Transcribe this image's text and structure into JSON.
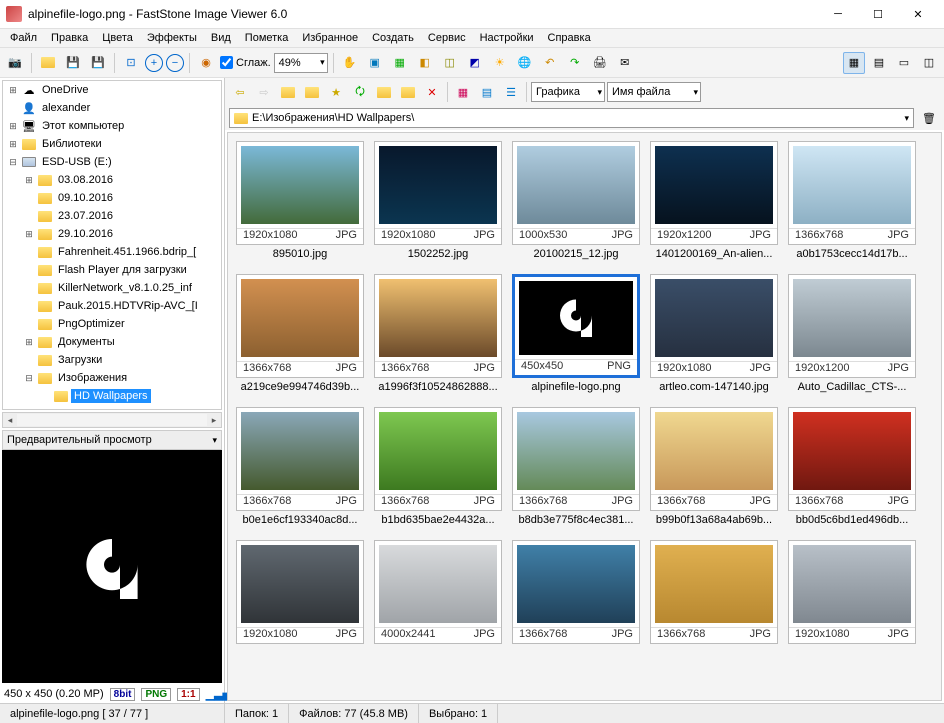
{
  "window": {
    "title": "alpinefile-logo.png  -  FastStone Image Viewer 6.0"
  },
  "menu": [
    "Файл",
    "Правка",
    "Цвета",
    "Эффекты",
    "Вид",
    "Пометка",
    "Избранное",
    "Создать",
    "Сервис",
    "Настройки",
    "Справка"
  ],
  "toolbar": {
    "smooth_label": "Сглаж.",
    "zoom_value": "49%",
    "view_combo": "Графика",
    "sort_combo": "Имя файла"
  },
  "path": "E:\\Изображения\\HD Wallpapers\\",
  "tree": [
    {
      "ind": 0,
      "exp": "+",
      "ico": "cloud",
      "label": "OneDrive"
    },
    {
      "ind": 0,
      "exp": "",
      "ico": "user",
      "label": "alexander"
    },
    {
      "ind": 0,
      "exp": "+",
      "ico": "pc",
      "label": "Этот компьютер"
    },
    {
      "ind": 0,
      "exp": "+",
      "ico": "lib",
      "label": "Библиотеки"
    },
    {
      "ind": 0,
      "exp": "-",
      "ico": "drv",
      "label": "ESD-USB (E:)"
    },
    {
      "ind": 1,
      "exp": "+",
      "ico": "fld",
      "label": "03.08.2016"
    },
    {
      "ind": 1,
      "exp": "",
      "ico": "fld",
      "label": "09.10.2016"
    },
    {
      "ind": 1,
      "exp": "",
      "ico": "fld",
      "label": "23.07.2016"
    },
    {
      "ind": 1,
      "exp": "+",
      "ico": "fld",
      "label": "29.10.2016"
    },
    {
      "ind": 1,
      "exp": "",
      "ico": "fld",
      "label": "Fahrenheit.451.1966.bdrip_["
    },
    {
      "ind": 1,
      "exp": "",
      "ico": "fld",
      "label": "Flash Player для загрузки"
    },
    {
      "ind": 1,
      "exp": "",
      "ico": "fld",
      "label": "KillerNetwork_v8.1.0.25_inf"
    },
    {
      "ind": 1,
      "exp": "",
      "ico": "fld",
      "label": "Pauk.2015.HDTVRip-AVC_[I"
    },
    {
      "ind": 1,
      "exp": "",
      "ico": "fld",
      "label": "PngOptimizer"
    },
    {
      "ind": 1,
      "exp": "+",
      "ico": "fld",
      "label": "Документы"
    },
    {
      "ind": 1,
      "exp": "",
      "ico": "fld",
      "label": "Загрузки"
    },
    {
      "ind": 1,
      "exp": "-",
      "ico": "fld",
      "label": "Изображения"
    },
    {
      "ind": 2,
      "exp": "",
      "ico": "fld",
      "label": "HD Wallpapers",
      "sel": true
    }
  ],
  "preview": {
    "header": "Предварительный просмотр",
    "info": "450 x 450 (0.20 MP)",
    "bit": "8bit",
    "fmt": "PNG",
    "ratio": "1:1"
  },
  "thumbs": [
    {
      "dim": "1920x1080",
      "fmt": "JPG",
      "name": "895010.jpg",
      "c": "linear-gradient(#7bb9d8,#436b3a)"
    },
    {
      "dim": "1920x1080",
      "fmt": "JPG",
      "name": "1502252.jpg",
      "c": "linear-gradient(#08182c,#0b3550)"
    },
    {
      "dim": "1000x530",
      "fmt": "JPG",
      "name": "20100215_12.jpg",
      "c": "linear-gradient(#b0cde0,#6e8a9a)"
    },
    {
      "dim": "1920x1200",
      "fmt": "JPG",
      "name": "1401200169_An-alien...",
      "c": "linear-gradient(#0e3050,#06121e)"
    },
    {
      "dim": "1366x768",
      "fmt": "JPG",
      "name": "a0b1753cecc14d17b...",
      "c": "linear-gradient(#cfe6f4,#8db0c4)"
    },
    {
      "dim": "1366x768",
      "fmt": "JPG",
      "name": "a219ce9e994746d39b...",
      "c": "linear-gradient(#d29050,#8c6030)"
    },
    {
      "dim": "1366x768",
      "fmt": "JPG",
      "name": "a1996f3f10524862888...",
      "c": "linear-gradient(#f0c070,#6b4a2a)"
    },
    {
      "dim": "450x450",
      "fmt": "PNG",
      "name": "alpinefile-logo.png",
      "sel": true,
      "alpine": true
    },
    {
      "dim": "1920x1080",
      "fmt": "JPG",
      "name": "artleo.com-147140.jpg",
      "c": "linear-gradient(#3a4e68,#263040)"
    },
    {
      "dim": "1920x1200",
      "fmt": "JPG",
      "name": "Auto_Cadillac_CTS-...",
      "c": "linear-gradient(#c0ccd4,#7c8890)"
    },
    {
      "dim": "1366x768",
      "fmt": "JPG",
      "name": "b0e1e6cf193340ac8d...",
      "c": "linear-gradient(#8aa8b8,#455a2e)"
    },
    {
      "dim": "1366x768",
      "fmt": "JPG",
      "name": "b1bd635bae2e4432a...",
      "c": "linear-gradient(#7ec850,#3d7a20)"
    },
    {
      "dim": "1366x768",
      "fmt": "JPG",
      "name": "b8db3e775f8c4ec381...",
      "c": "linear-gradient(#a8c8e0,#648a58)"
    },
    {
      "dim": "1366x768",
      "fmt": "JPG",
      "name": "b99b0f13a68a4ab69b...",
      "c": "linear-gradient(#f0d890,#c8985a)"
    },
    {
      "dim": "1366x768",
      "fmt": "JPG",
      "name": "bb0d5c6bd1ed496db...",
      "c": "linear-gradient(#d03020,#701810)"
    },
    {
      "dim": "1920x1080",
      "fmt": "JPG",
      "name": "",
      "c": "linear-gradient(#606870,#303438)"
    },
    {
      "dim": "4000x2441",
      "fmt": "JPG",
      "name": "",
      "c": "linear-gradient(#d8dadc,#a0a4a8)"
    },
    {
      "dim": "1366x768",
      "fmt": "JPG",
      "name": "",
      "c": "linear-gradient(#4080a8,#204058)"
    },
    {
      "dim": "1366x768",
      "fmt": "JPG",
      "name": "",
      "c": "linear-gradient(#e0b050,#b88830)"
    },
    {
      "dim": "1920x1080",
      "fmt": "JPG",
      "name": "",
      "c": "linear-gradient(#b8c0c8,#808890)"
    }
  ],
  "status": {
    "left": "alpinefile-logo.png [ 37 / 77 ]",
    "folders": "Папок:    1",
    "files": "Файлов: 77 (45.8 MB)",
    "selected": "Выбрано: 1"
  }
}
